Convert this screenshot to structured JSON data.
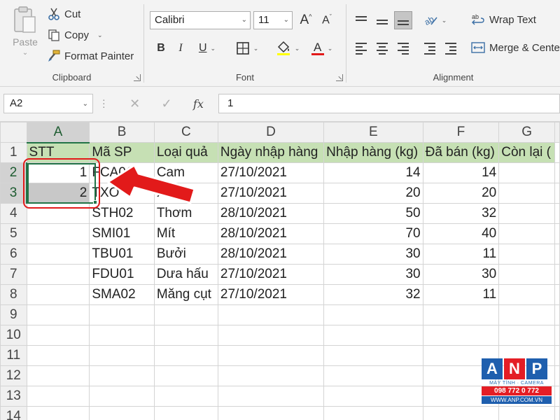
{
  "ribbon": {
    "clipboard": {
      "group_label": "Clipboard",
      "paste_label": "Paste",
      "cut_label": "Cut",
      "copy_label": "Copy",
      "format_painter_label": "Format Painter"
    },
    "font": {
      "group_label": "Font",
      "font_name": "Calibri",
      "font_size": "11",
      "bold": "B",
      "italic": "I",
      "underline": "U",
      "font_color_letter": "A",
      "grow_letter": "A",
      "shrink_letter": "A"
    },
    "alignment": {
      "group_label": "Alignment",
      "wrap_text_label": "Wrap Text",
      "merge_center_label": "Merge & Center"
    }
  },
  "formula_bar": {
    "name_box": "A2",
    "fx_label": "fx",
    "cancel_glyph": "✕",
    "enter_glyph": "✓",
    "formula_value": "1"
  },
  "sheet": {
    "columns": [
      "A",
      "B",
      "C",
      "D",
      "E",
      "F",
      "G"
    ],
    "active_column": "A",
    "row_numbers": [
      "1",
      "2",
      "3",
      "4",
      "5",
      "6",
      "7",
      "8",
      "9",
      "10",
      "11",
      "12",
      "13",
      "14"
    ],
    "header_row": [
      "STT",
      "Mã SP",
      "Loại quả",
      "Ngày nhập hàng",
      "Nhập hàng (kg)",
      "Đã bán (kg)",
      "Còn lại ("
    ],
    "rows": [
      [
        "1",
        "FCA01",
        "Cam",
        "27/10/2021",
        "14",
        "14"
      ],
      [
        "2",
        "TXO",
        "Xoài",
        "27/10/2021",
        "20",
        "20"
      ],
      [
        "",
        "STH02",
        "Thơm",
        "28/10/2021",
        "50",
        "32"
      ],
      [
        "",
        "SMI01",
        "Mít",
        "28/10/2021",
        "70",
        "40"
      ],
      [
        "",
        "TBU01",
        "Bưởi",
        "28/10/2021",
        "30",
        "11"
      ],
      [
        "",
        "FDU01",
        "Dưa hấu",
        "27/10/2021",
        "30",
        "30"
      ],
      [
        "",
        "SMA02",
        "Măng cụt",
        "27/10/2021",
        "32",
        "11"
      ]
    ]
  },
  "watermark": {
    "letters": [
      "A",
      "N",
      "P"
    ],
    "tagline": "MÁY TÍNH · CAMERA",
    "phone": "098 772 0 772",
    "website": "WWW.ANP.COM.VN"
  },
  "colors": {
    "excel_green": "#217346",
    "header_fill": "#c6e0b4",
    "annotation_red": "#e21a1a",
    "anp_blue": "#1f5fae",
    "anp_red": "#e41e25"
  }
}
